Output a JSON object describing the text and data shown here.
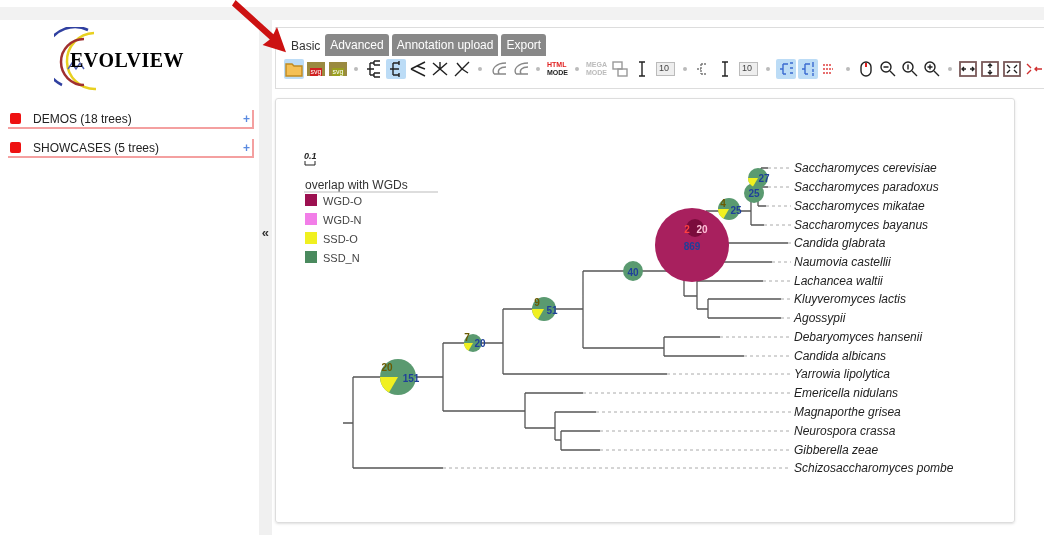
{
  "logo": {
    "text": "EVOLVIEW"
  },
  "sidebar": {
    "items": [
      {
        "label": "DEMOS (18 trees)",
        "toggle": "+"
      },
      {
        "label": "SHOWCASES (5 trees)",
        "toggle": "+"
      }
    ]
  },
  "collapse_toggle": "«",
  "tabs": [
    {
      "label": "Basic",
      "selected": true
    },
    {
      "label": "Advanced",
      "selected": false
    },
    {
      "label": "Annotation upload",
      "selected": false
    },
    {
      "label": "Export",
      "selected": false
    }
  ],
  "toolbar": [
    {
      "kind": "button",
      "selected": true
    },
    {
      "kind": "button",
      "selected": false,
      "label": "svg"
    },
    {
      "kind": "button",
      "selected": false,
      "label": "svg"
    },
    {
      "kind": "separator"
    },
    {
      "kind": "button",
      "selected": false
    },
    {
      "kind": "button",
      "selected": true
    },
    {
      "kind": "button",
      "selected": false
    },
    {
      "kind": "button",
      "selected": false
    },
    {
      "kind": "button",
      "selected": false
    },
    {
      "kind": "separator"
    },
    {
      "kind": "button",
      "selected": false
    },
    {
      "kind": "button",
      "selected": false
    },
    {
      "kind": "separator"
    },
    {
      "kind": "mode",
      "label_top": "HTML",
      "label_bottom": "MODE",
      "disabled": false
    },
    {
      "kind": "separator"
    },
    {
      "kind": "mode",
      "label_top": "MEGA",
      "label_bottom": "MODE",
      "disabled": true
    },
    {
      "kind": "button",
      "selected": false
    },
    {
      "kind": "button",
      "selected": false
    },
    {
      "kind": "input",
      "value": "10"
    },
    {
      "kind": "separator"
    },
    {
      "kind": "button",
      "selected": false
    },
    {
      "kind": "button",
      "selected": false
    },
    {
      "kind": "input",
      "value": "10"
    },
    {
      "kind": "separator"
    },
    {
      "kind": "button",
      "selected": true
    },
    {
      "kind": "button",
      "selected": true
    },
    {
      "kind": "button",
      "selected": false
    },
    {
      "kind": "separator"
    },
    {
      "kind": "button",
      "selected": false
    },
    {
      "kind": "button",
      "selected": false
    },
    {
      "kind": "button",
      "selected": false
    },
    {
      "kind": "button",
      "selected": false
    },
    {
      "kind": "separator"
    },
    {
      "kind": "button",
      "selected": false
    },
    {
      "kind": "button",
      "selected": false
    },
    {
      "kind": "button",
      "selected": false
    },
    {
      "kind": "button",
      "selected": false
    }
  ],
  "canvas": {
    "scale_bar": "0.1",
    "legend": {
      "title": "overlap with WGDs",
      "items": [
        {
          "label": "WGD-O",
          "color": "#9c1050"
        },
        {
          "label": "WGD-N",
          "color": "#f27ee8"
        },
        {
          "label": "SSD-O",
          "color": "#f0f020"
        },
        {
          "label": "SSD_N",
          "color": "#4a8a5e"
        }
      ]
    },
    "leaves": [
      "Saccharomyces cerevisiae",
      "Saccharomyces paradoxus",
      "Saccharomyces mikatae",
      "Saccharomyces bayanus",
      "Candida glabrata",
      "Naumovia castellii",
      "Lachancea waltii",
      "Kluyveromyces lactis",
      "Agossypii",
      "Debaryomyces hansenii",
      "Candida albicans",
      "Yarrowia lipolytica",
      "Emericella nidulans",
      "Magnaporthe grisea",
      "Neurospora crassa",
      "Gibberella zeae",
      "Schizosaccharomyces pombe"
    ],
    "nodes": [
      {
        "kind": "pie",
        "labels": [
          {
            "text": "20",
            "kind": "ssd_o"
          },
          {
            "text": "151",
            "kind": "ssd_n"
          }
        ]
      },
      {
        "kind": "pie",
        "labels": [
          {
            "text": "7",
            "kind": "ssd_o"
          },
          {
            "text": "20",
            "kind": "ssd_n"
          }
        ]
      },
      {
        "kind": "pie",
        "labels": [
          {
            "text": "9",
            "kind": "ssd_o"
          },
          {
            "text": "51",
            "kind": "ssd_n"
          }
        ]
      },
      {
        "kind": "plain",
        "labels": [
          {
            "text": "40",
            "kind": "ssd_n"
          }
        ]
      },
      {
        "kind": "wgd",
        "labels": [
          {
            "text": "2",
            "kind": "wgd_n"
          },
          {
            "text": "20",
            "kind": "wgd_o"
          },
          {
            "text": "869",
            "kind": "ssd_n"
          }
        ]
      },
      {
        "kind": "pie",
        "labels": [
          {
            "text": "4",
            "kind": "ssd_o"
          },
          {
            "text": "25",
            "kind": "ssd_n"
          }
        ]
      },
      {
        "kind": "plain",
        "labels": [
          {
            "text": "25",
            "kind": "ssd_n"
          }
        ]
      },
      {
        "kind": "pie",
        "labels": [
          {
            "text": "27",
            "kind": "ssd_n"
          }
        ]
      }
    ]
  }
}
